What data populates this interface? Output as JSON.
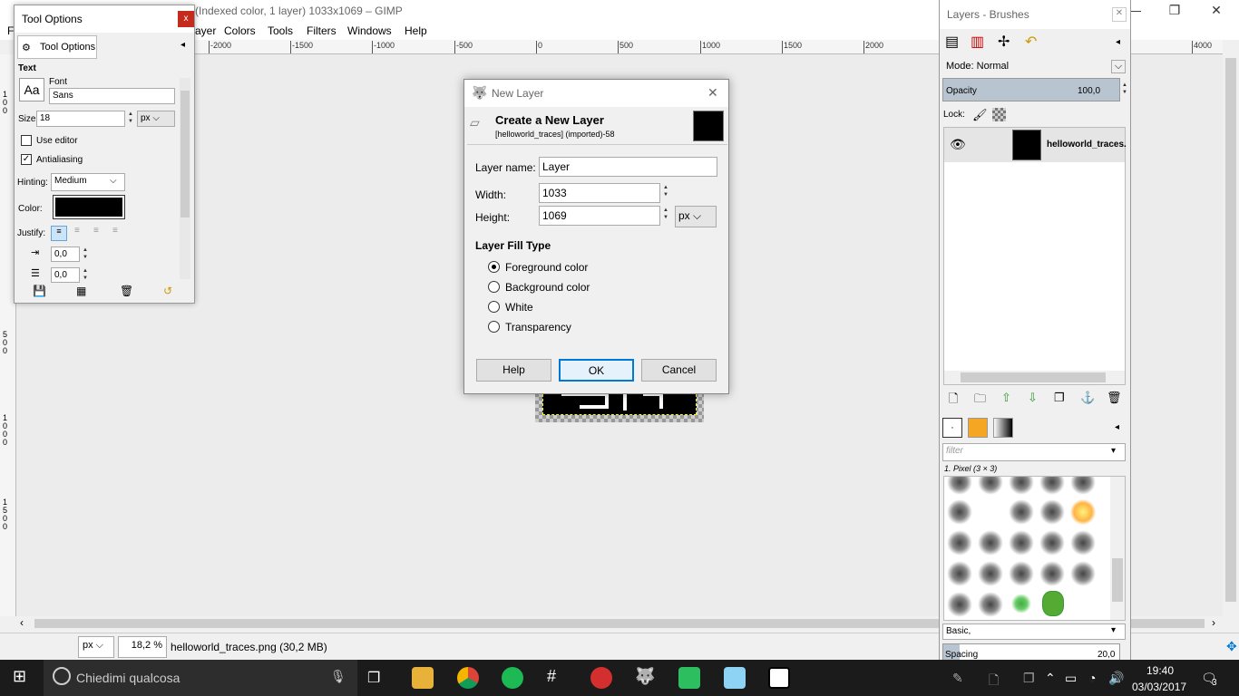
{
  "window": {
    "title": "(Indexed color, 1 layer) 1033x1069 – GIMP",
    "menus": [
      "F",
      "ayer",
      "Colors",
      "Tools",
      "Filters",
      "Windows",
      "Help"
    ],
    "controls": [
      "—",
      "❐",
      "✕"
    ]
  },
  "ruler": {
    "ticks": [
      "-2000",
      "-1500",
      "-1000",
      "-500",
      "0",
      "500",
      "1000",
      "1500",
      "2000",
      "4000"
    ],
    "vticks": [
      "1\n0\n0",
      "5\n0\n0",
      "1\n0\n0\n0",
      "1\n5\n0\n0"
    ]
  },
  "statusbar": {
    "unit": "px",
    "zoom": "18,2 %",
    "file": "helloworld_traces.png (30,2 MB)"
  },
  "tool_options": {
    "title": "Tool Options",
    "close": "x",
    "tab_label": "Tool Options",
    "section": "Text",
    "font_label": "Font",
    "font_value": "Sans",
    "font_icon_text": "Aa",
    "size_label": "Size:",
    "size_value": "18",
    "size_unit": "px",
    "use_editor": "Use editor",
    "use_editor_checked": false,
    "antialiasing": "Antialiasing",
    "antialiasing_checked": true,
    "hinting_label": "Hinting:",
    "hinting_value": "Medium",
    "color_label": "Color:",
    "color_value": "#000000",
    "justify_label": "Justify:",
    "indent_value": "0,0",
    "line_spacing_value": "0,0"
  },
  "layers_dock": {
    "title": "Layers - Brushes",
    "mode_label": "Mode: Normal",
    "opacity_label": "Opacity",
    "opacity_value": "100,0",
    "lock_label": "Lock:",
    "layer_name": "helloworld_traces.",
    "filter_placeholder": "filter",
    "brush_name": "1. Pixel (3 × 3)",
    "brush_tag": "Basic,",
    "spacing_label": "Spacing",
    "spacing_value": "20,0"
  },
  "dialog": {
    "window_title": "New Layer",
    "heading": "Create a New Layer",
    "subheading": "[helloworld_traces] (imported)-58",
    "layer_name_label": "Layer name:",
    "layer_name_value": "Layer",
    "width_label": "Width:",
    "width_value": "1033",
    "height_label": "Height:",
    "height_value": "1069",
    "unit": "px",
    "fill_type_title": "Layer Fill Type",
    "fill_options": [
      "Foreground color",
      "Background color",
      "White",
      "Transparency"
    ],
    "selected_fill": "Foreground color",
    "help_button": "Help",
    "ok_button": "OK",
    "cancel_button": "Cancel"
  },
  "taskbar": {
    "search_placeholder": "Chiedimi qualcosa",
    "time": "19:40",
    "date": "03/03/2017",
    "notifications": "3"
  }
}
